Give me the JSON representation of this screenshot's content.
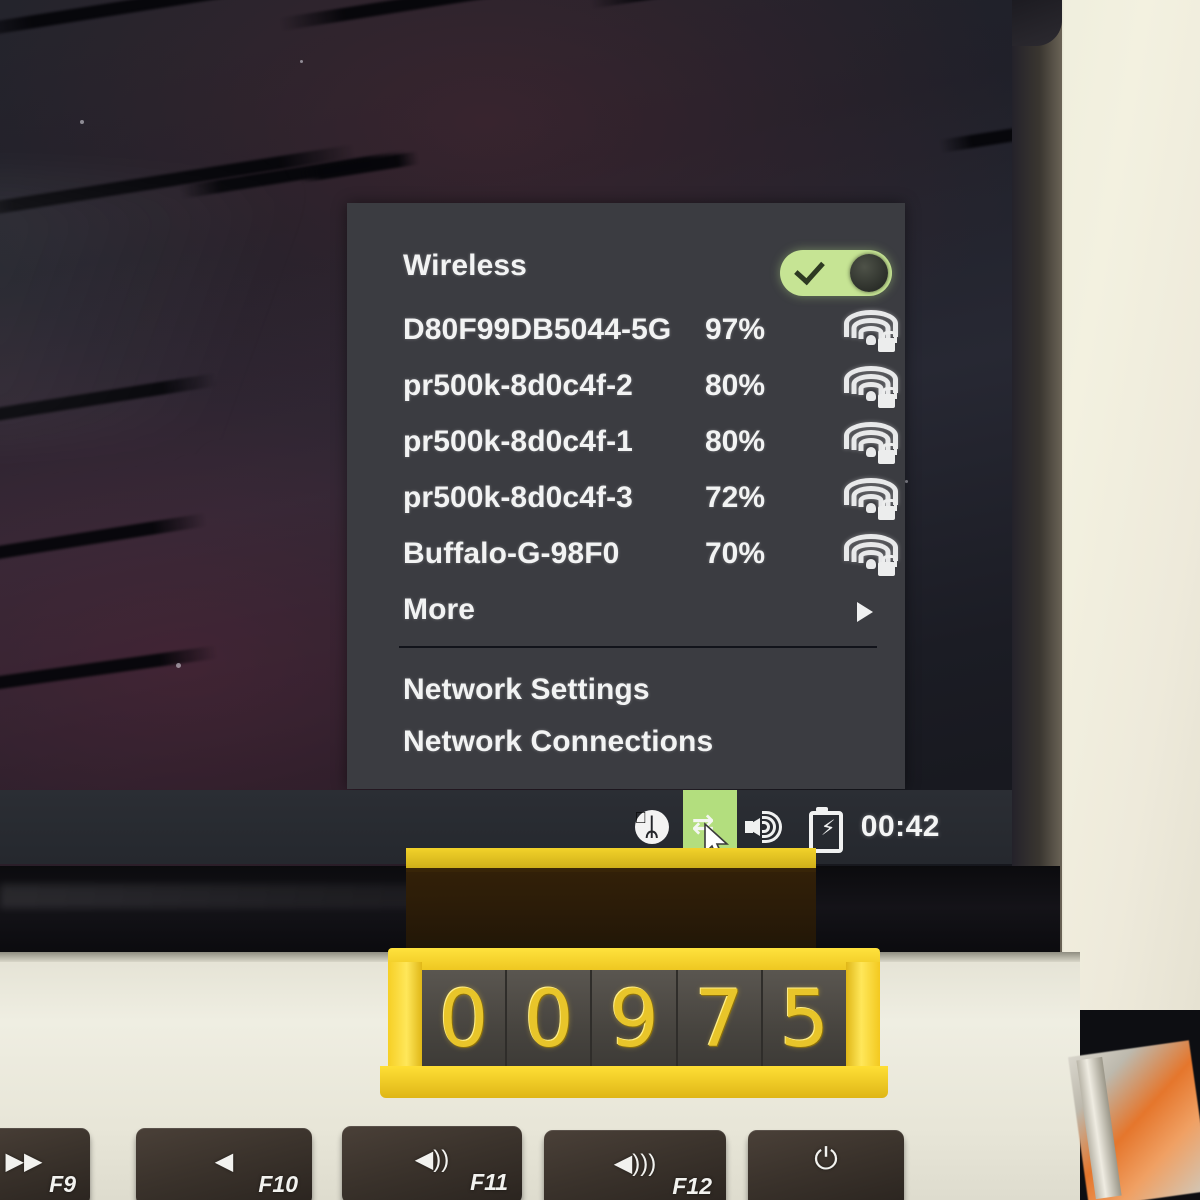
{
  "scene": {
    "description": "Photograph of a laptop screen showing an open wireless network menu",
    "wall_color": "#efeedd",
    "screen_bg": "#1f2029"
  },
  "menu": {
    "panel_color": "#3b3c41",
    "toggle": {
      "label": "Wireless",
      "state": "on",
      "track_color": "#c6e494",
      "knob_color": "#2b2e29",
      "check_icon": "check-icon"
    },
    "networks": [
      {
        "ssid": "D80F99DB5044-5G",
        "signal": "97%",
        "icon": "wifi-locked-icon"
      },
      {
        "ssid": "pr500k-8d0c4f-2",
        "signal": "80%",
        "icon": "wifi-locked-icon"
      },
      {
        "ssid": "pr500k-8d0c4f-1",
        "signal": "80%",
        "icon": "wifi-locked-icon"
      },
      {
        "ssid": "pr500k-8d0c4f-3",
        "signal": "72%",
        "icon": "wifi-locked-icon"
      },
      {
        "ssid": "Buffalo-G-98F0",
        "signal": "70%",
        "icon": "wifi-locked-icon"
      }
    ],
    "more": {
      "label": "More",
      "icon": "caret-right-icon"
    },
    "actions": [
      {
        "label": "Network Settings"
      },
      {
        "label": "Network Connections"
      }
    ]
  },
  "taskbar": {
    "bg_color": "#2b2e34",
    "bluetooth": {
      "icon": "bluetooth-icon",
      "glyph": "ᛦ"
    },
    "network": {
      "icon": "network-arrows-icon",
      "glyph": "⇄",
      "highlight_color": "#b3de7e",
      "cursor": "mouse-pointer-icon"
    },
    "volume": {
      "icon": "volume-icon"
    },
    "battery": {
      "icon": "battery-charging-icon",
      "glyph": "⚡"
    },
    "clock": "00:42"
  },
  "counter": {
    "digits": [
      "0",
      "0",
      "9",
      "7",
      "5"
    ],
    "value": "00975",
    "frame_color": "#ffdf35",
    "digit_color": "#e8c52a",
    "track_color": "#47443f"
  },
  "keyboard": {
    "keys": [
      {
        "fn": "F9",
        "glyph": "▶▶",
        "name": "next-track-key"
      },
      {
        "fn": "F10",
        "glyph": "◀",
        "name": "mute-key"
      },
      {
        "fn": "F11",
        "glyph": "◀))",
        "name": "volume-down-key"
      },
      {
        "fn": "F12",
        "glyph": "◀)))",
        "name": "volume-up-key"
      },
      {
        "fn": "",
        "glyph": "⏻",
        "name": "power-key"
      }
    ]
  }
}
